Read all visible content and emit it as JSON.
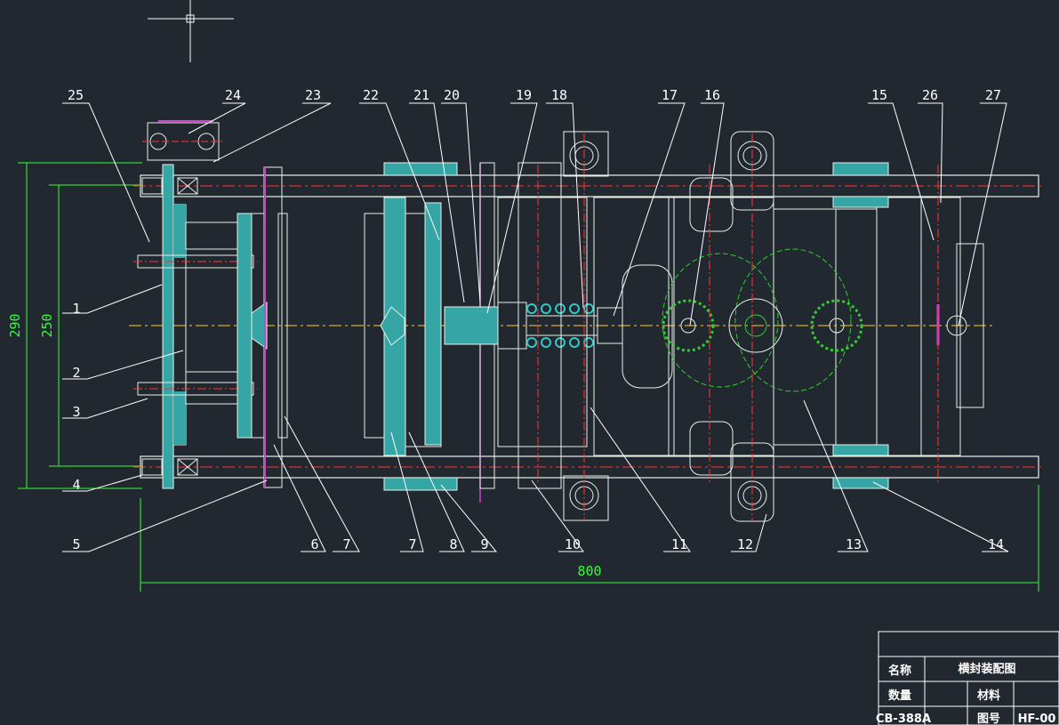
{
  "drawing": {
    "background": "#212830",
    "colors": {
      "outline": "#e8f0e8",
      "green": "#33ff33",
      "red": "#ff3333",
      "cyan": "#33c8c8",
      "magenta": "#d040d0",
      "white": "#ffffff",
      "part_fill": "#35a5a5"
    }
  },
  "dimensions": {
    "overall_length": "800",
    "height_outer": "290",
    "height_inner": "250"
  },
  "callouts": {
    "top": [
      "25",
      "24",
      "23",
      "22",
      "21",
      "20",
      "19",
      "18",
      "17",
      "16",
      "15",
      "26",
      "27"
    ],
    "left": [
      "1",
      "2",
      "3",
      "4"
    ],
    "bottom": [
      "5",
      "6",
      "7",
      "7",
      "8",
      "9",
      "10",
      "11",
      "12",
      "13",
      "14"
    ]
  },
  "title_block": {
    "name_label": "名称",
    "name_value": "横封装配图",
    "qty_label": "数量",
    "material_label": "材料",
    "model": "CB-388A",
    "drawing_no_label": "图号",
    "drawing_no_value": "HF-00"
  }
}
